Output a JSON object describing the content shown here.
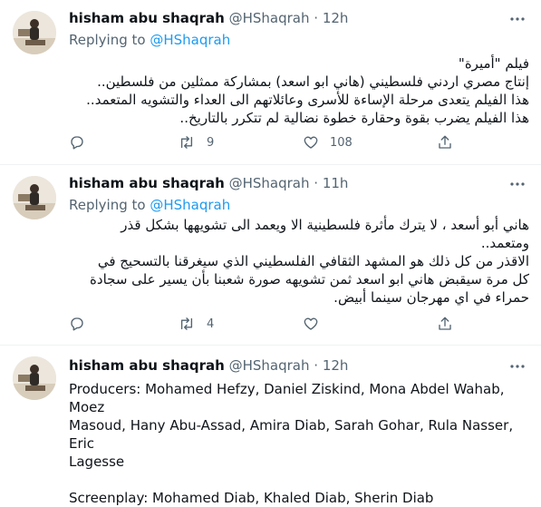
{
  "colors": {
    "accent": "#1d9bf0",
    "muted": "#536471",
    "text": "#0f1419",
    "divider": "#eff3f4"
  },
  "tweets": [
    {
      "name": "hisham abu shaqrah",
      "handle": "@HShaqrah",
      "separator": "·",
      "time": "12h",
      "replying_prefix": "Replying to ",
      "replying_handle": "@HShaqrah",
      "lines": [
        "فيلم \"أميرة\"",
        "إنتاج مصري اردني فلسطيني (هاني ابو اسعد) بمشاركة ممثلين من فلسطين..",
        "هذا الفيلم يتعدى مرحلة الإساءة للأسرى وعائلاتهم الى العداء والتشويه المتعمد..",
        "هذا الفيلم يضرب بقوة وحقارة خطوة نضالية لم تتكرر بالتاريخ.."
      ],
      "replies": "",
      "retweets": "9",
      "likes": "108"
    },
    {
      "name": "hisham abu shaqrah",
      "handle": "@HShaqrah",
      "separator": "·",
      "time": "11h",
      "replying_prefix": "Replying to ",
      "replying_handle": "@HShaqrah",
      "lines": [
        "هاني أبو أسعد ، لا يترك مأثرة فلسطينية الا ويعمد الى تشويهها بشكل قذر",
        "ومتعمد..",
        "الاقذر من كل ذلك هو المشهد الثقافي الفلسطيني الذي سيغرقنا بالتسحيج في",
        "كل مرة سيقبض هاني ابو اسعد ثمن تشويهه صورة شعبنا بأن يسير على سجادة",
        "حمراء في اي مهرجان سينما أبيض."
      ],
      "replies": "",
      "retweets": "4",
      "likes": ""
    },
    {
      "name": "hisham abu shaqrah",
      "handle": "@HShaqrah",
      "separator": "·",
      "time": "12h",
      "lines": [
        "Producers: Mohamed Hefzy, Daniel Ziskind, Mona Abdel Wahab, Moez",
        "Masoud, Hany Abu-Assad, Amira Diab, Sarah Gohar, Rula Nasser, Eric",
        "Lagesse",
        "",
        "Screenplay: Mohamed Diab, Khaled Diab, Sherin Diab"
      ]
    }
  ],
  "icons": {
    "avatar": "avatar-photo",
    "more": "more-horizontal-icon",
    "reply": "reply-icon",
    "retweet": "retweet-icon",
    "like": "heart-icon",
    "share": "share-icon"
  }
}
